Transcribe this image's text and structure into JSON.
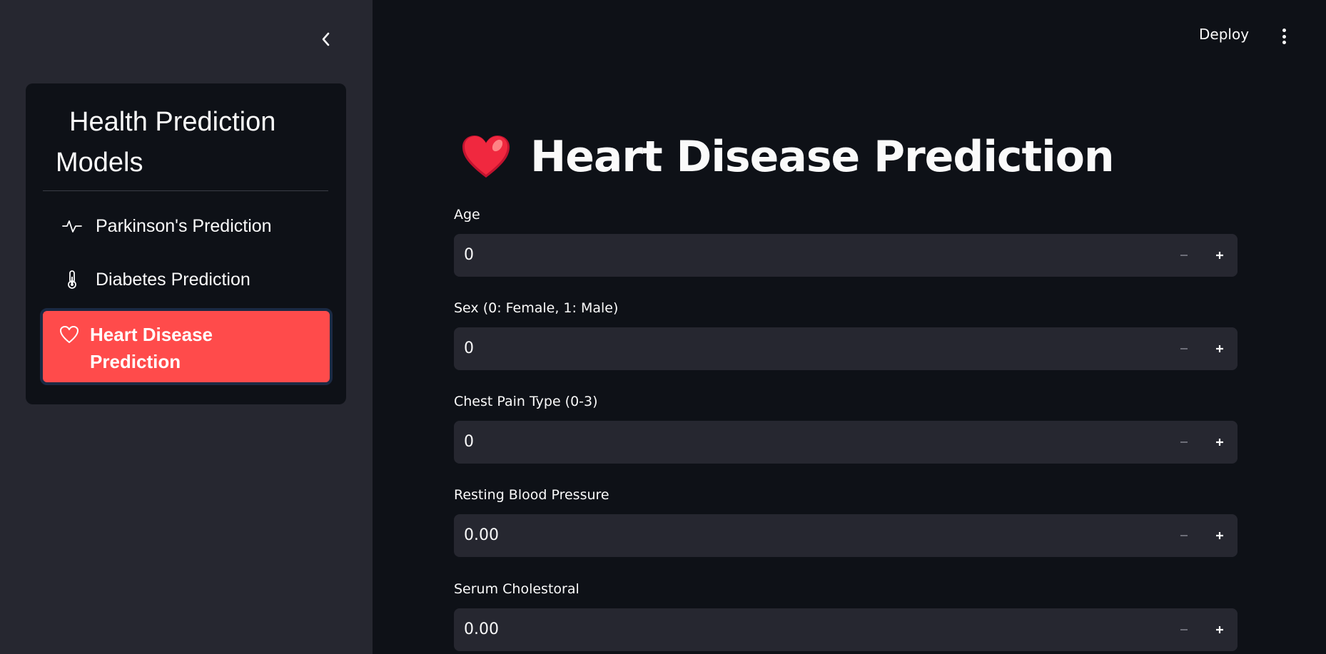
{
  "header": {
    "deploy_label": "Deploy"
  },
  "sidebar": {
    "title": "Health Prediction Models",
    "items": [
      {
        "label": "Parkinson's Prediction",
        "icon": "activity-icon"
      },
      {
        "label": "Diabetes Prediction",
        "icon": "thermometer-icon"
      },
      {
        "label": "Heart Disease Prediction",
        "icon": "heart-icon",
        "active": true
      }
    ]
  },
  "main": {
    "title": "Heart Disease Prediction",
    "title_icon": "red-heart-emoji",
    "fields": [
      {
        "label": "Age",
        "value": "0"
      },
      {
        "label": "Sex (0: Female, 1: Male)",
        "value": "0"
      },
      {
        "label": "Chest Pain Type (0-3)",
        "value": "0"
      },
      {
        "label": "Resting Blood Pressure",
        "value": "0.00"
      },
      {
        "label": "Serum Cholestoral",
        "value": "0.00"
      }
    ]
  },
  "colors": {
    "background": "#0e1117",
    "sidebar": "#262730",
    "accent": "#ff4b4b",
    "input_bg": "#262730"
  }
}
